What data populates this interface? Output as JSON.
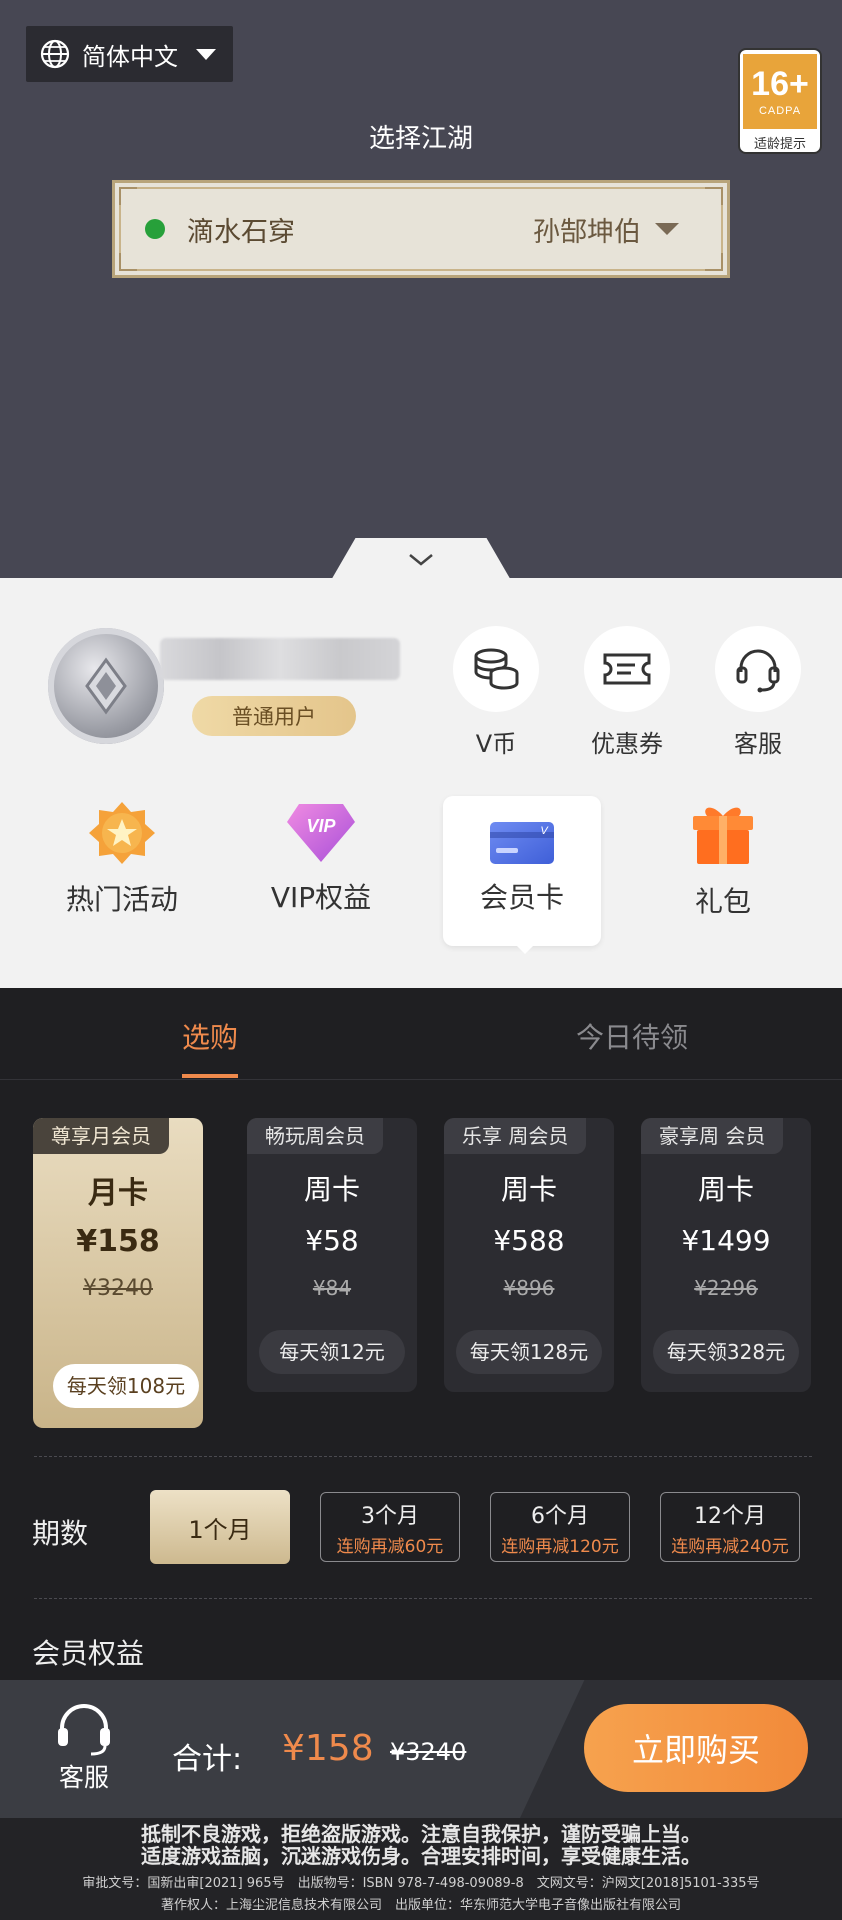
{
  "header": {
    "language": "简体中文",
    "age_rating": {
      "number": "16+",
      "org": "CADPA",
      "tip": "适龄提示"
    },
    "realm_title": "选择江湖",
    "server": {
      "name": "滴水石穿",
      "role": "孙郜坤伯",
      "status_color": "#27a03a"
    }
  },
  "user": {
    "level": "普通用户"
  },
  "quick_actions": [
    {
      "label": "V币",
      "icon": "coins-icon"
    },
    {
      "label": "优惠券",
      "icon": "ticket-icon"
    },
    {
      "label": "客服",
      "icon": "headset-icon"
    }
  ],
  "features": [
    {
      "label": "热门活动",
      "icon": "star-badge-icon"
    },
    {
      "label": "VIP权益",
      "icon": "vip-diamond-icon"
    },
    {
      "label": "会员卡",
      "icon": "member-card-icon",
      "active": true
    },
    {
      "label": "礼包",
      "icon": "gift-icon"
    }
  ],
  "tabs": {
    "buy": "选购",
    "daily": "今日待领",
    "active": "buy"
  },
  "plans": [
    {
      "tag": "尊享月会员",
      "name": "月卡",
      "price": "¥158",
      "original": "¥3240",
      "daily": "每天领108元",
      "selected": true
    },
    {
      "tag": "畅玩周会员",
      "name": "周卡",
      "price": "¥58",
      "original": "¥84",
      "daily": "每天领12元"
    },
    {
      "tag": "乐享 周会员",
      "name": "周卡",
      "price": "¥588",
      "original": "¥896",
      "daily": "每天领128元"
    },
    {
      "tag": "豪享周 会员",
      "name": "周卡",
      "price": "¥1499",
      "original": "¥2296",
      "daily": "每天领328元"
    }
  ],
  "period": {
    "label": "期数",
    "options": [
      {
        "main": "1个月",
        "sub": "",
        "selected": true
      },
      {
        "main": "3个月",
        "sub": "连购再减60元"
      },
      {
        "main": "6个月",
        "sub": "连购再减120元"
      },
      {
        "main": "12个月",
        "sub": "连购再减240元"
      }
    ]
  },
  "benefits_title": "会员权益",
  "checkout": {
    "service_label": "客服",
    "total_label": "合计:",
    "total_price": "¥158",
    "total_original": "¥3240",
    "buy_label": "立即购买"
  },
  "footer": {
    "line1": "抵制不良游戏，拒绝盗版游戏。注意自我保护，谨防受骗上当。",
    "line2": "适度游戏益脑，沉迷游戏伤身。合理安排时间，享受健康生活。",
    "line3": "审批文号：国新出审[2021] 965号　出版物号：ISBN 978-7-498-09089-8　文网文号：沪网文[2018]5101-335号",
    "line4": "著作权人：上海尘泥信息技术有限公司　出版单位：华东师范大学电子音像出版社有限公司"
  },
  "colors": {
    "accent": "#ef8a4c",
    "gold": "#d6c39a",
    "dark_bg": "#1f1f22",
    "top_bg": "#474753"
  }
}
